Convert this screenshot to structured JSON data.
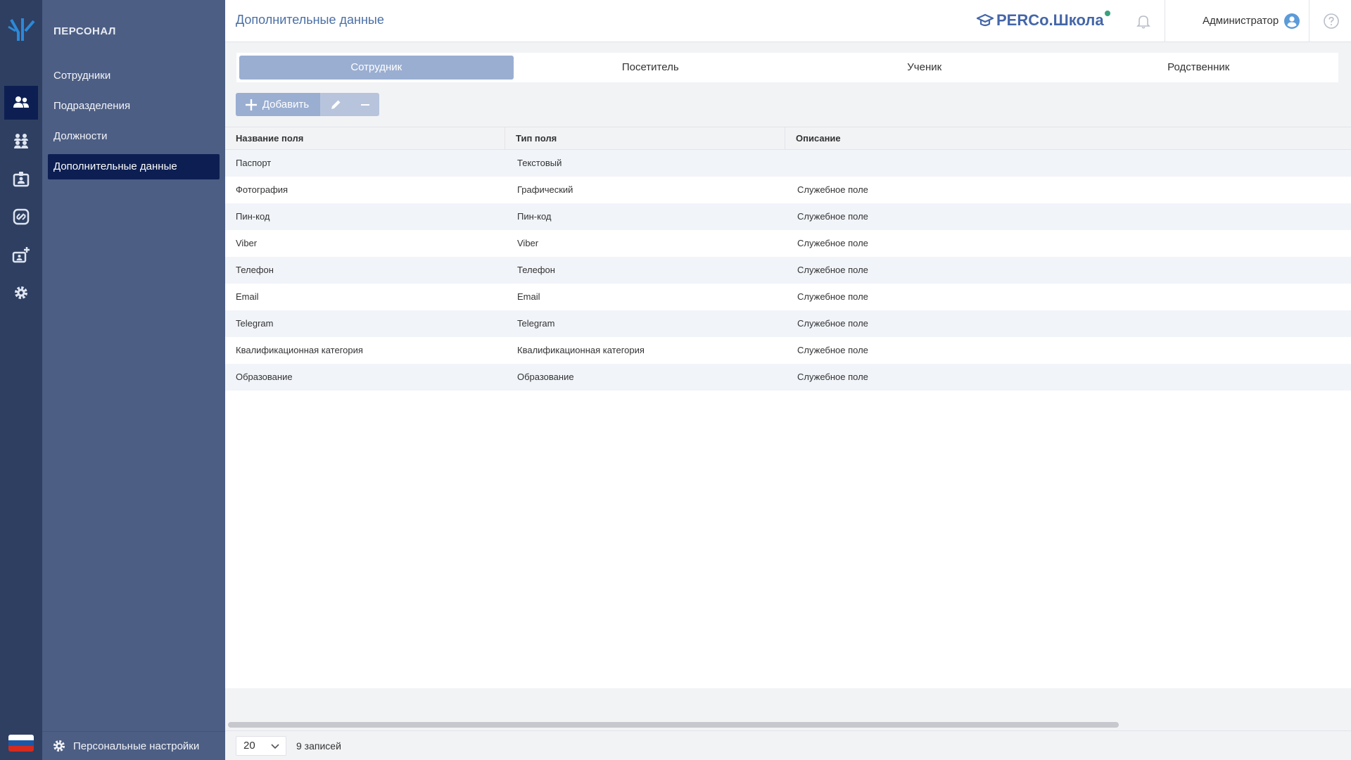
{
  "header": {
    "title": "Дополнительные данные",
    "brand": "PERCo.Школа",
    "user": "Администратор"
  },
  "sidebar": {
    "section": "ПЕРСОНАЛ",
    "items": [
      {
        "label": "Сотрудники"
      },
      {
        "label": "Подразделения"
      },
      {
        "label": "Должности"
      },
      {
        "label": "Дополнительные данные"
      }
    ],
    "footer_label": "Персональные настройки"
  },
  "rail_icons": [
    "users-icon",
    "group-icon",
    "id-card-icon",
    "link-icon",
    "add-badge-icon",
    "gear-icon"
  ],
  "tabs": [
    {
      "label": "Сотрудник"
    },
    {
      "label": "Посетитель"
    },
    {
      "label": "Ученик"
    },
    {
      "label": "Родственник"
    }
  ],
  "toolbar": {
    "add_label": "Добавить"
  },
  "table": {
    "columns": [
      "Название поля",
      "Тип поля",
      "Описание"
    ],
    "rows": [
      [
        "Паспорт",
        "Текстовый",
        ""
      ],
      [
        "Фотография",
        "Графический",
        "Служебное поле"
      ],
      [
        "Пин-код",
        "Пин-код",
        "Служебное поле"
      ],
      [
        "Viber",
        "Viber",
        "Служебное поле"
      ],
      [
        "Телефон",
        "Телефон",
        "Служебное поле"
      ],
      [
        "Email",
        "Email",
        "Служебное поле"
      ],
      [
        "Telegram",
        "Telegram",
        "Служебное поле"
      ],
      [
        "Квалификационная категория",
        "Квалификационная категория",
        "Служебное поле"
      ],
      [
        "Образование",
        "Образование",
        "Служебное поле"
      ]
    ]
  },
  "footer": {
    "page_size": "20",
    "records": "9 записей"
  },
  "colors": {
    "rail": "#2e3f61",
    "nav": "#4d5e84",
    "active": "#0d1f52",
    "accent": "#9aaed1",
    "brand": "#4466a8"
  }
}
